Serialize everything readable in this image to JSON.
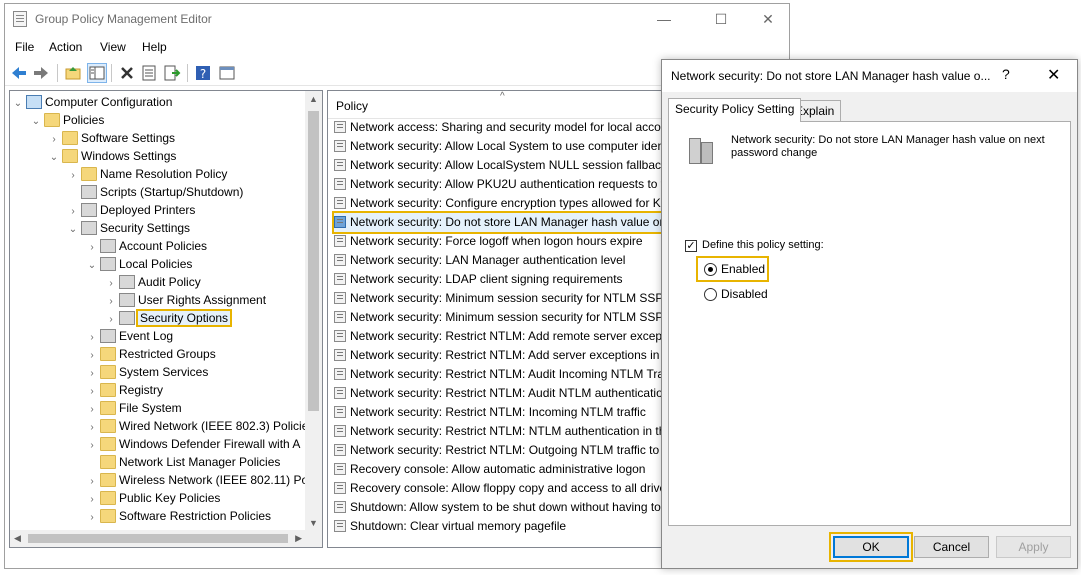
{
  "window": {
    "title": "Group Policy Management Editor",
    "controls": {
      "minimize": "—",
      "maximize": "☐",
      "close": "✕"
    }
  },
  "menu": [
    "File",
    "Action",
    "View",
    "Help"
  ],
  "toolbar": {
    "icons": [
      "back-icon",
      "forward-icon",
      "up-folder-icon",
      "show-tree-icon",
      "delete-icon",
      "properties-icon",
      "export-icon",
      "help-icon",
      "view-icon"
    ]
  },
  "tree": {
    "items": [
      {
        "label": "Computer Configuration",
        "chev": "⌄",
        "icon": "computer-icon"
      },
      {
        "label": "Policies",
        "chev": "⌄",
        "icon": "folder-icon"
      },
      {
        "label": "Software Settings",
        "chev": "›",
        "icon": "folder-icon"
      },
      {
        "label": "Windows Settings",
        "chev": "⌄",
        "icon": "folder-icon"
      },
      {
        "label": "Name Resolution Policy",
        "chev": "›",
        "icon": "folder-icon"
      },
      {
        "label": "Scripts (Startup/Shutdown)",
        "chev": "",
        "icon": "script-icon"
      },
      {
        "label": "Deployed Printers",
        "chev": "›",
        "icon": "printer-icon"
      },
      {
        "label": "Security Settings",
        "chev": "⌄",
        "icon": "security-icon"
      },
      {
        "label": "Account Policies",
        "chev": "›",
        "icon": "security-icon"
      },
      {
        "label": "Local Policies",
        "chev": "⌄",
        "icon": "security-icon"
      },
      {
        "label": "Audit Policy",
        "chev": "›",
        "icon": "security-icon"
      },
      {
        "label": "User Rights Assignment",
        "chev": "›",
        "icon": "security-icon"
      },
      {
        "label": "Security Options",
        "chev": "›",
        "icon": "security-icon",
        "selected": true
      },
      {
        "label": "Event Log",
        "chev": "›",
        "icon": "security-icon"
      },
      {
        "label": "Restricted Groups",
        "chev": "›",
        "icon": "folder-icon"
      },
      {
        "label": "System Services",
        "chev": "›",
        "icon": "folder-icon"
      },
      {
        "label": "Registry",
        "chev": "›",
        "icon": "folder-icon"
      },
      {
        "label": "File System",
        "chev": "›",
        "icon": "folder-icon"
      },
      {
        "label": "Wired Network (IEEE 802.3) Policie",
        "chev": "›",
        "icon": "folder-icon"
      },
      {
        "label": "Windows Defender Firewall with A",
        "chev": "›",
        "icon": "folder-icon"
      },
      {
        "label": "Network List Manager Policies",
        "chev": "",
        "icon": "folder-icon"
      },
      {
        "label": "Wireless Network (IEEE 802.11) Po",
        "chev": "›",
        "icon": "folder-icon"
      },
      {
        "label": "Public Key Policies",
        "chev": "›",
        "icon": "folder-icon"
      },
      {
        "label": "Software Restriction Policies",
        "chev": "›",
        "icon": "folder-icon"
      }
    ]
  },
  "list": {
    "header": "Policy",
    "sort_glyph": "^",
    "rows": [
      "Network access: Sharing and security model for local accou",
      "Network security: Allow Local System to use computer ident",
      "Network security: Allow LocalSystem NULL session fallback",
      "Network security: Allow PKU2U authentication requests to t",
      "Network security: Configure encryption types allowed for Ke",
      "Network security: Do not store LAN Manager hash value on",
      "Network security: Force logoff when logon hours expire",
      "Network security: LAN Manager authentication level",
      "Network security: LDAP client signing requirements",
      "Network security: Minimum session security for NTLM SSP .",
      "Network security: Minimum session security for NTLM SSP .",
      "Network security: Restrict NTLM: Add remote server excepti",
      "Network security: Restrict NTLM: Add server exceptions in t.",
      "Network security: Restrict NTLM: Audit Incoming NTLM Tra",
      "Network security: Restrict NTLM: Audit NTLM authenticatio",
      "Network security: Restrict NTLM: Incoming NTLM traffic",
      "Network security: Restrict NTLM: NTLM authentication in th",
      "Network security: Restrict NTLM: Outgoing NTLM traffic to",
      "Recovery console: Allow automatic administrative logon",
      "Recovery console: Allow floppy copy and access to all drives",
      "Shutdown: Allow system to be shut down without having to",
      "Shutdown: Clear virtual memory pagefile"
    ],
    "selected_index": 5
  },
  "dialog": {
    "title": "Network security: Do not store LAN Manager hash value o...",
    "help": "?",
    "close": "✕",
    "tabs": [
      "Security Policy Setting",
      "Explain"
    ],
    "description": "Network security: Do not store LAN Manager hash value on next password change",
    "define_label": "Define this policy setting:",
    "define_checked": true,
    "check_glyph": "✓",
    "options": [
      "Enabled",
      "Disabled"
    ],
    "selected_option": "Enabled",
    "buttons": {
      "ok": "OK",
      "cancel": "Cancel",
      "apply": "Apply"
    }
  },
  "colors": {
    "highlight": "#e8b400",
    "selection": "#e5f1fb",
    "accent": "#0078d7"
  }
}
